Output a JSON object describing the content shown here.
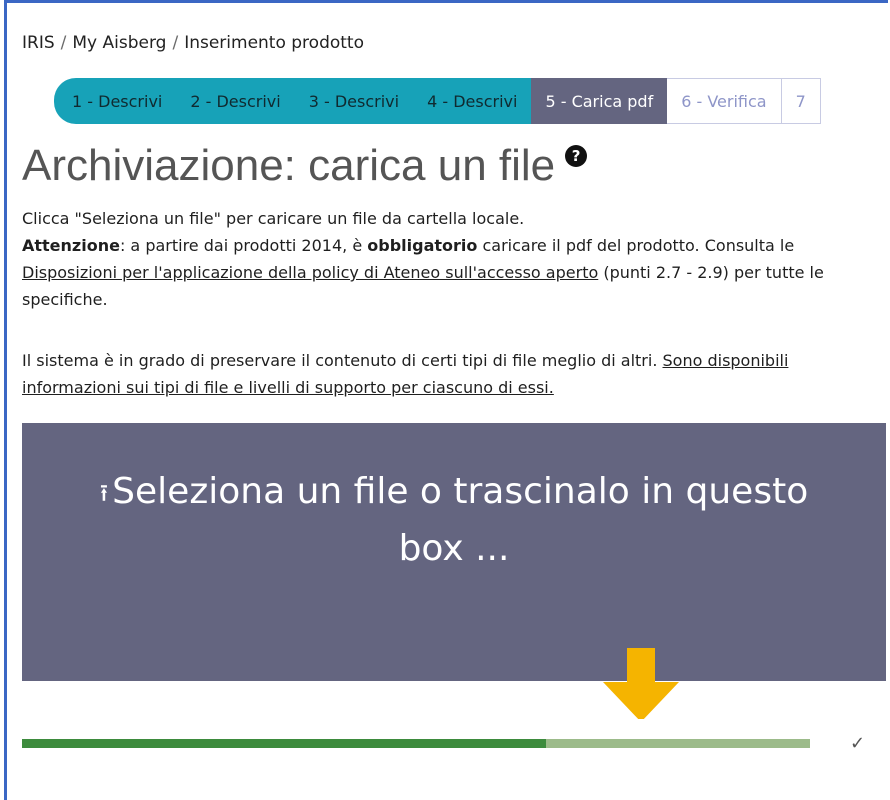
{
  "breadcrumb": [
    {
      "label": "IRIS"
    },
    {
      "label": "My Aisberg"
    },
    {
      "label": "Inserimento prodotto"
    }
  ],
  "breadcrumb_separator": "/",
  "steps": [
    {
      "label": "1 - Descrivi",
      "state": "done"
    },
    {
      "label": "2 - Descrivi",
      "state": "done"
    },
    {
      "label": "3 - Descrivi",
      "state": "done"
    },
    {
      "label": "4 - Descrivi",
      "state": "done"
    },
    {
      "label": "5 - Carica pdf",
      "state": "active"
    },
    {
      "label": "6 - Verifica",
      "state": "todo"
    },
    {
      "label": "7",
      "state": "todo"
    }
  ],
  "page_title": "Archiviazione: carica un file",
  "help_icon": "question-circle-icon",
  "instructions": {
    "line1": "Clicca \"Seleziona un file\" per caricare un file da cartella locale.",
    "attention_label": "Attenzione",
    "attention_text_1": ": a partire dai prodotti 2014, è ",
    "mandatory": "obbligatorio",
    "attention_text_2": " caricare il pdf del prodotto. Consulta le ",
    "policy_link": "Disposizioni per l'applicazione della policy di Ateneo sull'accesso aperto",
    "attention_text_3": " (punti 2.7 - 2.9) per tutte le specifiche."
  },
  "formats": {
    "text": "Il sistema è in grado di preservare il contenuto di certi tipi di file meglio di altri. ",
    "link": "Sono disponibili informazioni sui tipi di file e livelli di supporto per ciascuno di essi."
  },
  "dropzone": {
    "icon": "upload-icon",
    "label": "Seleziona un file o trascinalo in questo box ..."
  },
  "upload_progress": {
    "fraction": 0.665,
    "status_icon": "check-icon"
  },
  "colors": {
    "step_done": "#17a2b8",
    "step_active": "#646580",
    "dropzone_bg": "#646580",
    "progress_fill": "#3d8b3d",
    "progress_track": "#9cbb8a",
    "annotation_arrow": "#f5b400",
    "frame_border": "#3b67c4"
  }
}
